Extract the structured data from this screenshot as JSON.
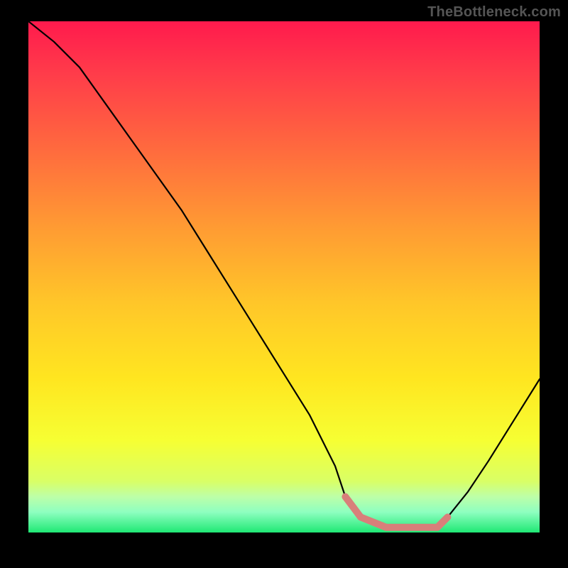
{
  "watermark": "TheBottleneck.com",
  "chart_data": {
    "type": "line",
    "title": "",
    "xlabel": "",
    "ylabel": "",
    "xlim": [
      0,
      100
    ],
    "ylim": [
      0,
      100
    ],
    "grid": false,
    "series": [
      {
        "name": "bottleneck-curve",
        "x": [
          0,
          5,
          10,
          15,
          20,
          25,
          30,
          35,
          40,
          45,
          50,
          55,
          60,
          62,
          65,
          70,
          75,
          80,
          82,
          86,
          90,
          95,
          100
        ],
        "values": [
          100,
          96,
          91,
          84,
          77,
          70,
          63,
          55,
          47,
          39,
          31,
          23,
          13,
          7,
          3,
          1,
          1,
          1,
          3,
          8,
          14,
          22,
          30
        ]
      }
    ],
    "highlight": {
      "name": "near-zero-segment",
      "x": [
        62,
        65,
        70,
        75,
        80,
        82
      ],
      "values": [
        7,
        3,
        1,
        1,
        1,
        3
      ],
      "color": "#d87f7a"
    },
    "background_gradient": {
      "stops": [
        {
          "offset": 0.0,
          "color": "#ff1a4d"
        },
        {
          "offset": 0.1,
          "color": "#ff3b4a"
        },
        {
          "offset": 0.25,
          "color": "#ff6a3e"
        },
        {
          "offset": 0.4,
          "color": "#ff9a33"
        },
        {
          "offset": 0.55,
          "color": "#ffc629"
        },
        {
          "offset": 0.7,
          "color": "#ffe620"
        },
        {
          "offset": 0.82,
          "color": "#f6ff33"
        },
        {
          "offset": 0.9,
          "color": "#d9ff66"
        },
        {
          "offset": 0.93,
          "color": "#bdffa8"
        },
        {
          "offset": 0.96,
          "color": "#8effc0"
        },
        {
          "offset": 1.0,
          "color": "#1fe874"
        }
      ]
    }
  }
}
